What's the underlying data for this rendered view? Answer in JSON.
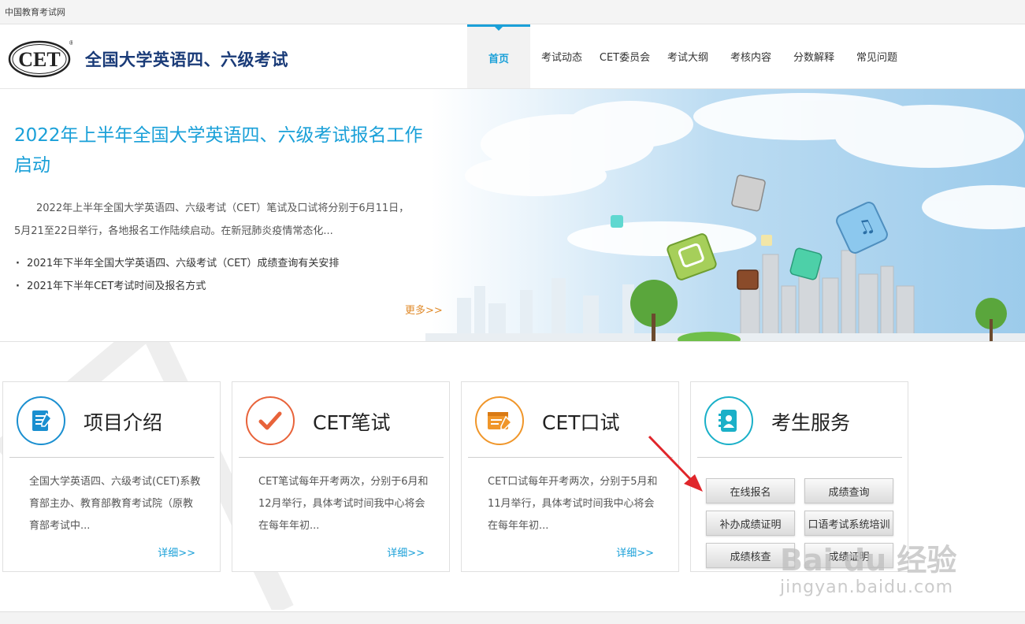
{
  "topbar": {
    "site_name": "中国教育考试网"
  },
  "header": {
    "logo_text": "CET",
    "logo_mark": "®",
    "title": "全国大学英语四、六级考试"
  },
  "nav": [
    {
      "label": "首页",
      "active": true
    },
    {
      "label": "考试动态"
    },
    {
      "label": "CET委员会"
    },
    {
      "label": "考试大纲"
    },
    {
      "label": "考核内容"
    },
    {
      "label": "分数解释"
    },
    {
      "label": "常见问题"
    }
  ],
  "banner": {
    "headline": "2022年上半年全国大学英语四、六级考试报名工作启动",
    "summary": "2022年上半年全国大学英语四、六级考试（CET）笔试及口试将分别于6月11日，5月21至22日举行，各地报名工作陆续启动。在新冠肺炎疫情常态化...",
    "links": [
      "2021年下半年全国大学英语四、六级考试（CET）成绩查询有关安排",
      "2021年下半年CET考试时间及报名方式"
    ],
    "more": "更多>>"
  },
  "cards": [
    {
      "title": "项目介绍",
      "icon": "document-edit-icon",
      "color": "#1a8fd0",
      "text": "全国大学英语四、六级考试(CET)系教育部主办、教育部教育考试院（原教育部考试中...",
      "more": "详细>>"
    },
    {
      "title": "CET笔试",
      "icon": "checkmark-icon",
      "color": "#e8633a",
      "text": "CET笔试每年开考两次，分别于6月和12月举行，具体考试时间我中心将会在每年年初...",
      "more": "详细>>"
    },
    {
      "title": "CET口试",
      "icon": "form-edit-icon",
      "color": "#f0962a",
      "text": "CET口试每年开考两次，分别于5月和11月举行，具体考试时间我中心将会在每年年初...",
      "more": "详细>>"
    },
    {
      "title": "考生服务",
      "icon": "contact-book-icon",
      "color": "#1ab0c8",
      "buttons": [
        "在线报名",
        "成绩查询",
        "补办成绩证明",
        "口语考试系统培训",
        "成绩核查",
        "成绩证明"
      ]
    }
  ],
  "watermark": {
    "brand": "Bai du 经验",
    "url": "jingyan.baidu.com"
  },
  "colors": {
    "accent": "#1aa0d8",
    "title_blue": "#1a3b78",
    "orange": "#e08a2a",
    "arrow": "#e0262b"
  }
}
